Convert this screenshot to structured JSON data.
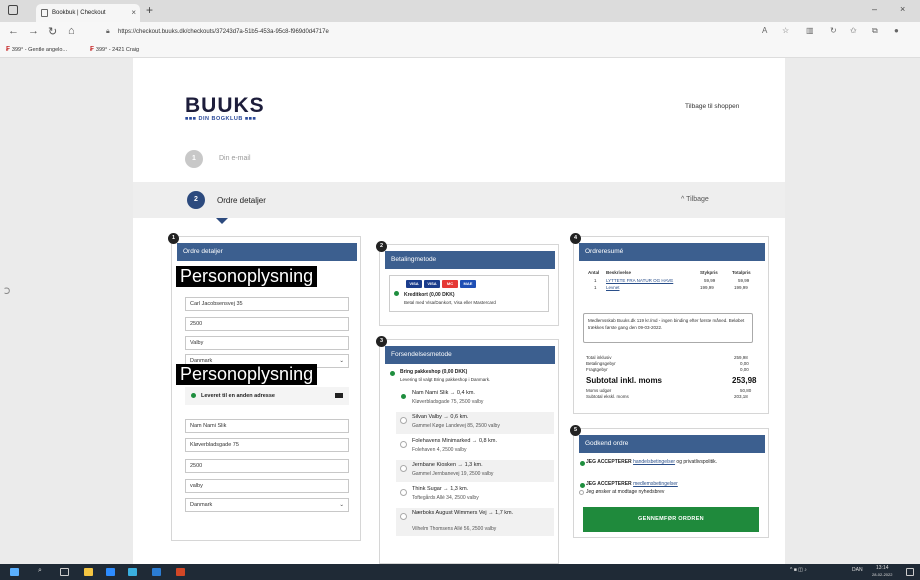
{
  "browser": {
    "tab_title": "Bookbuk | Checkout",
    "tab_close": "×",
    "new_tab": "+",
    "win_min": "–",
    "win_close": "×",
    "url": "https://checkout.buuks.dk/checkouts/37243d7a-51b5-453a-95c8-f969d0d4717e",
    "bookmarks": [
      "399° - Gentle angelo...",
      "399° - 2421 Craig"
    ]
  },
  "header": {
    "logo": "BUUKS",
    "logo_sub": "■■■ DIN BOGKLUB ■■■",
    "back_to_shop": "Tilbage til shoppen"
  },
  "steps": {
    "step1_num": "1",
    "step1_label": "Din e-mail",
    "step2_num": "2",
    "step2_label": "Ordre detaljer",
    "step2_back": "^ Tilbage"
  },
  "order_details": {
    "badge": "1",
    "title": "Ordre detaljer",
    "redaction": "Personoplysning",
    "address": "Carl Jacobsensvej 35",
    "zip": "2500",
    "city": "Valby",
    "country": "Danmark",
    "alt_delivery": "Leveret til en anden adresse",
    "alt_name": "Nam Nami Slik",
    "alt_street": "Kløverbladsgade 75",
    "alt_zip": "2500",
    "alt_city": "valby",
    "alt_country": "Danmark"
  },
  "payment": {
    "badge": "2",
    "title": "Betalingmetode",
    "card_label": "Kreditkort (0,00 DKK)",
    "card_desc": "Betal med Visa/Dankort, Visa eller Mastercard",
    "logo_visa1": "VISA",
    "logo_visa2": "VISA",
    "logo_mc": "MC",
    "logo_maestro": "MAE"
  },
  "shipping": {
    "badge": "3",
    "title": "Forsendelsesmetode",
    "method": "Bring pakkeshop (0,00 DKK)",
    "method_desc": "Levering til valgt Bring pakkeshop i Danmark.",
    "items": [
      {
        "name": "Nam Nami Slik → 0,4 km.",
        "addr": "Kløverbladsgade 75, 2500 valby"
      },
      {
        "name": "Silvan Valby → 0,6 km.",
        "addr": "Gammel Køge Landevej 85, 2500 valby"
      },
      {
        "name": "Folehavens Minimarked → 0,8 km.",
        "addr": "Folehaven 4, 2500 valby"
      },
      {
        "name": "Jernbane Kiosken → 1,3 km.",
        "addr": "Gammel Jernbanevej 19, 2500 valby"
      },
      {
        "name": "Think Sugar → 1,3 km.",
        "addr": "Toftegårds Allé 34, 2500 valby"
      },
      {
        "name": "Nærboks August Wimmers Vej → 1,7 km.",
        "addr": "Vilhelm Thomsens Allé 56, 2500 valby"
      }
    ]
  },
  "summary": {
    "badge": "4",
    "title": "Ordreresumé",
    "col_qty": "Antal",
    "col_desc": "Beskrivelse",
    "col_unit": "Stykpris",
    "col_total": "Totalpris",
    "lines": [
      {
        "qty": "1",
        "desc": "LYTTETE FRA NATUR OG HAVE",
        "unit": "59,99",
        "total": "59,99"
      },
      {
        "qty": "1",
        "desc": "Levnet",
        "unit": "199,99",
        "total": "199,99"
      }
    ],
    "note": "Medlemsskab Buuks.dk 119 kr./md - ingen binding efter første måned. Beløbet trækkes første gang den 09-03-2022.",
    "total_ex_label": "Total inklusiv",
    "total_ex_value": "259,98",
    "fee_label": "Betalingsgebyr",
    "fee_value": "0,00",
    "freight_label": "Fragtgebyr",
    "freight_value": "0,00",
    "subtotal_label": "Subtotal inkl. moms",
    "subtotal_value": "253,98",
    "vat_label": "Moms udgør",
    "vat_value": "50,80",
    "subtotal_ex_label": "Subtotal ekskl. moms",
    "subtotal_ex_value": "203,18"
  },
  "approve": {
    "badge": "5",
    "title": "Godkend ordre",
    "accept1_bold": "JEG ACCEPTERER",
    "accept1_link": "handelsbetingelser",
    "accept1_rest": " og privatlivspolitik.",
    "accept2_bold": "JEG ACCEPTERER",
    "accept2_link": "medlemsbetingelser",
    "newsletter": "Jeg ønsker at modtage nyhedsbrev",
    "submit": "GENNEMFØR ORDREN"
  },
  "taskbar": {
    "lang": "DAN",
    "time": "13:14",
    "date": "28-02-2022"
  },
  "colors": {
    "accent_blue": "#3c5f8f",
    "confirm_green": "#1f8a3c",
    "logo_navy": "#1d1d3b"
  }
}
